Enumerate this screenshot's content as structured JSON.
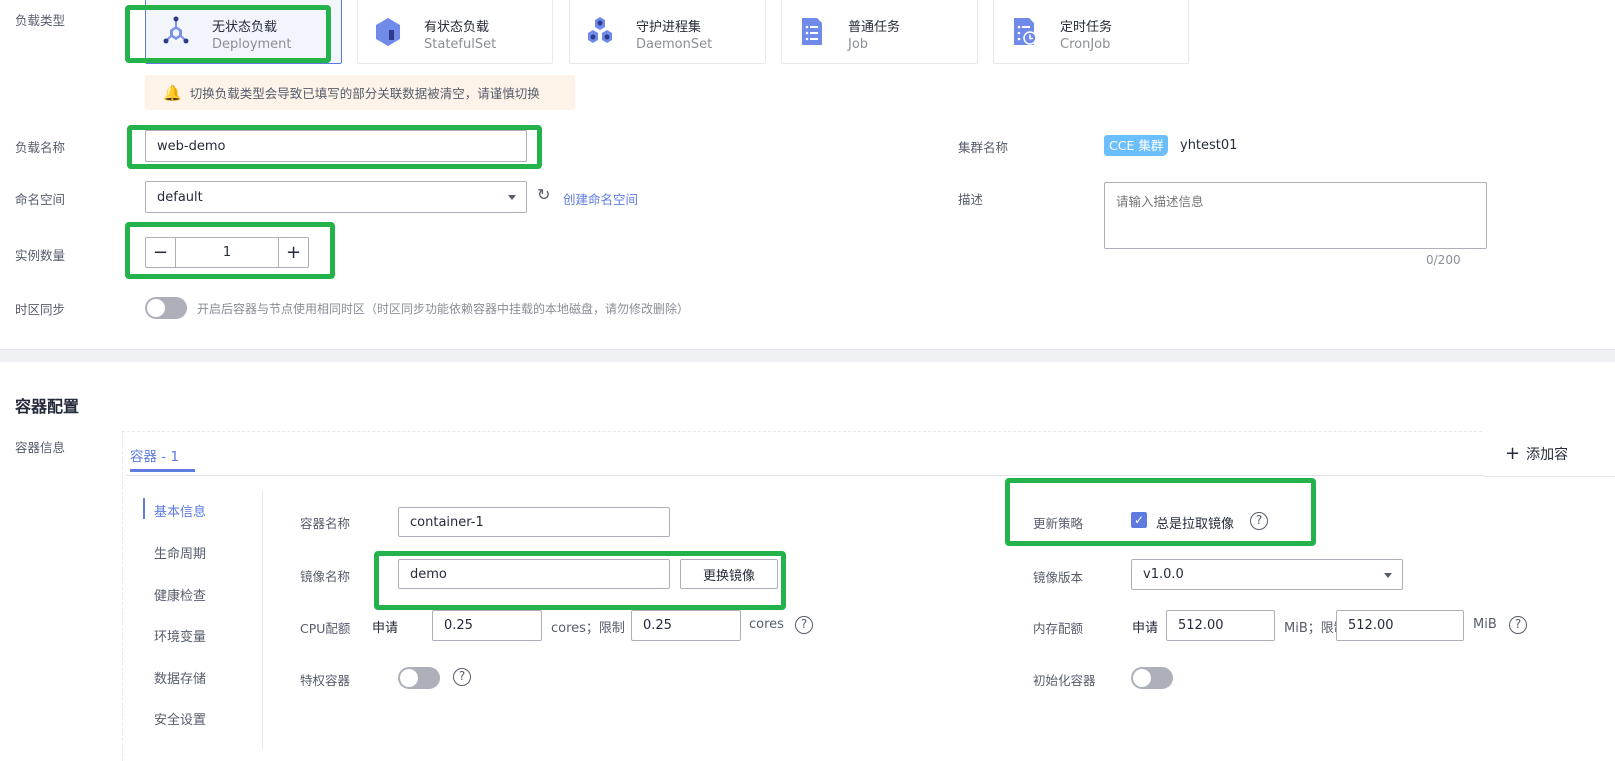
{
  "workload": {
    "type_label": "负载类型",
    "types": [
      {
        "title": "无状态负载",
        "subtitle": "Deployment",
        "icon": "deployment-icon",
        "selected": true
      },
      {
        "title": "有状态负载",
        "subtitle": "StatefulSet",
        "icon": "statefulset-icon",
        "selected": false
      },
      {
        "title": "守护进程集",
        "subtitle": "DaemonSet",
        "icon": "daemonset-icon",
        "selected": false
      },
      {
        "title": "普通任务",
        "subtitle": "Job",
        "icon": "job-icon",
        "selected": false
      },
      {
        "title": "定时任务",
        "subtitle": "CronJob",
        "icon": "cronjob-icon",
        "selected": false
      }
    ],
    "warning": "切换负载类型会导致已填写的部分关联数据被清空，请谨慎切换",
    "name_label": "负载名称",
    "name_value": "web-demo",
    "cluster_label": "集群名称",
    "cluster_badge": "CCE 集群",
    "cluster_name": "yhtest01",
    "namespace_label": "命名空间",
    "namespace_value": "default",
    "create_namespace": "创建命名空间",
    "desc_label": "描述",
    "desc_placeholder": "请输入描述信息",
    "desc_count": "0/200",
    "replicas_label": "实例数量",
    "replicas_value": "1",
    "tz_label": "时区同步",
    "tz_enabled": false,
    "tz_hint": "开启后容器与节点使用相同时区（时区同步功能依赖容器中挂载的本地磁盘，请勿修改删除）"
  },
  "container": {
    "section_title": "容器配置",
    "info_label": "容器信息",
    "tab": "容器 - 1",
    "add_button": "添加容",
    "nav": [
      "基本信息",
      "生命周期",
      "健康检查",
      "环境变量",
      "数据存储",
      "安全设置"
    ],
    "active_nav": "基本信息",
    "name_label": "容器名称",
    "name_value": "container-1",
    "image_label": "镜像名称",
    "image_value": "demo",
    "change_image": "更换镜像",
    "cpu_label": "CPU配额",
    "request": "申请",
    "cpu_request": "0.25",
    "cpu_unit_limit": "cores；限制",
    "cpu_limit": "0.25",
    "cpu_unit": "cores",
    "privileged_label": "特权容器",
    "privileged": false,
    "update_label": "更新策略",
    "always_pull": "总是拉取镜像",
    "always_pull_checked": true,
    "version_label": "镜像版本",
    "version_value": "v1.0.0",
    "mem_label": "内存配额",
    "mem_request": "512.00",
    "mem_unit_limit": "MiB；限制",
    "mem_limit": "512.00",
    "mem_unit": "MiB",
    "init_label": "初始化容器",
    "init": false
  },
  "colors": {
    "accent": "#5e7ce0",
    "highlight": "#24b24b",
    "badge": "#6cbfff",
    "warning_bg": "#fef3e8"
  }
}
